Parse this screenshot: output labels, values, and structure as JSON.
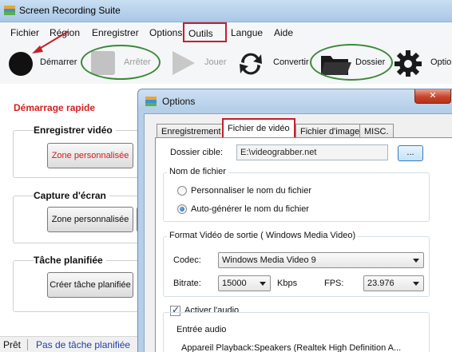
{
  "window": {
    "title": "Screen Recording Suite"
  },
  "menu": {
    "items": [
      "Fichier",
      "Région",
      "Enregistrer",
      "Options",
      "Outils",
      "Langue",
      "Aide"
    ],
    "active": "Outils"
  },
  "toolbar": {
    "start": "Démarrer",
    "stop": "Arrêter",
    "play": "Jouer",
    "convert": "Convertir",
    "folder": "Dossier",
    "options": "Options"
  },
  "left_panel": {
    "quick_start": "Démarrage rapide",
    "sections": [
      {
        "title": "Enregistrer vidéo",
        "button": "Zone personnalisée"
      },
      {
        "title": "Capture d'écran",
        "button": "Zone personnalisée"
      },
      {
        "title": "Tâche planifiée",
        "button": "Créer tâche planifiée"
      }
    ]
  },
  "status": {
    "ready": "Prêt",
    "schedule": "Pas de tâche planifiée"
  },
  "dialog": {
    "title": "Options",
    "close": "✕",
    "tabs": [
      "Enregistrement",
      "Fichier de vidéo",
      "Fichier d'image",
      "MISC."
    ],
    "selected_tab": "Fichier de vidéo",
    "dest_folder_label": "Dossier cible:",
    "dest_folder_value": "E:\\videograbber.net",
    "browse": "...",
    "filename_group": "Nom de fichier",
    "radio_custom": "Personnaliser le nom du fichier",
    "radio_auto": "Auto-générer le nom du fichier",
    "format_group": "Format Vidéo de sortie ( Windows Media Video)",
    "codec_label": "Codec:",
    "codec_value": "Windows Media Video 9",
    "bitrate_label": "Bitrate:",
    "bitrate_value": "15000",
    "kbps": "Kbps",
    "fps_label": "FPS:",
    "fps_value": "23.976",
    "audio_enable": "Activer l'audio",
    "audio_input_group": "Entrée audio",
    "audio_device": "Appareil Playback:Speakers (Realtek High Definition A..."
  },
  "colors": {
    "highlight_red": "#c2202c",
    "annotation_green": "#3a8a3a",
    "quick_start_red": "#d41f1f",
    "link_blue": "#1f3ea8"
  }
}
